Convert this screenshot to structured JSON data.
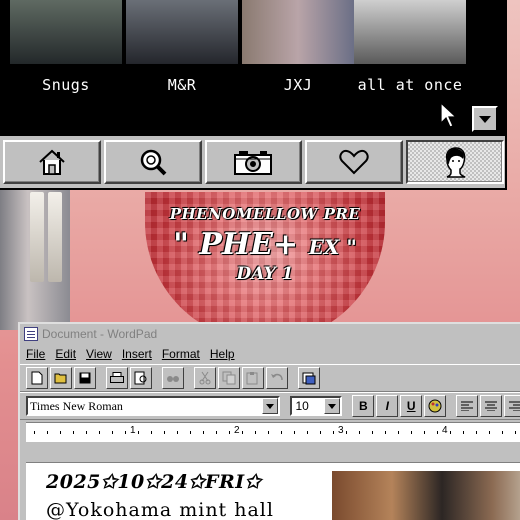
{
  "members": [
    {
      "name": "Snugs"
    },
    {
      "name": "M&R"
    },
    {
      "name": "JXJ"
    },
    {
      "name": "all at once"
    }
  ],
  "nav_icons": [
    {
      "icon": "home-icon"
    },
    {
      "icon": "search-icon"
    },
    {
      "icon": "camera-icon"
    },
    {
      "icon": "heart-icon"
    },
    {
      "icon": "portrait-icon",
      "active": true
    }
  ],
  "event": {
    "line1": "PHENOMELLOW PRE",
    "line2_main": "\" PHE+ ",
    "line2_small": "EX \"",
    "line3": "DAY 1"
  },
  "wordpad": {
    "title": "Document - WordPad",
    "menu": [
      "File",
      "Edit",
      "View",
      "Insert",
      "Format",
      "Help"
    ],
    "font_name": "Times New Roman",
    "font_size": "10",
    "format_buttons": [
      "B",
      "I",
      "U"
    ],
    "ruler_numbers": [
      "1",
      "2",
      "3",
      "4"
    ],
    "doc_date": "2025✩10✩24✩FRI✩",
    "doc_venue": "@Yokohama mint hall"
  },
  "colors": {
    "win_gray": "#c0c0c0",
    "strip_black": "#000000",
    "mosaic_red": "#c8343b"
  }
}
